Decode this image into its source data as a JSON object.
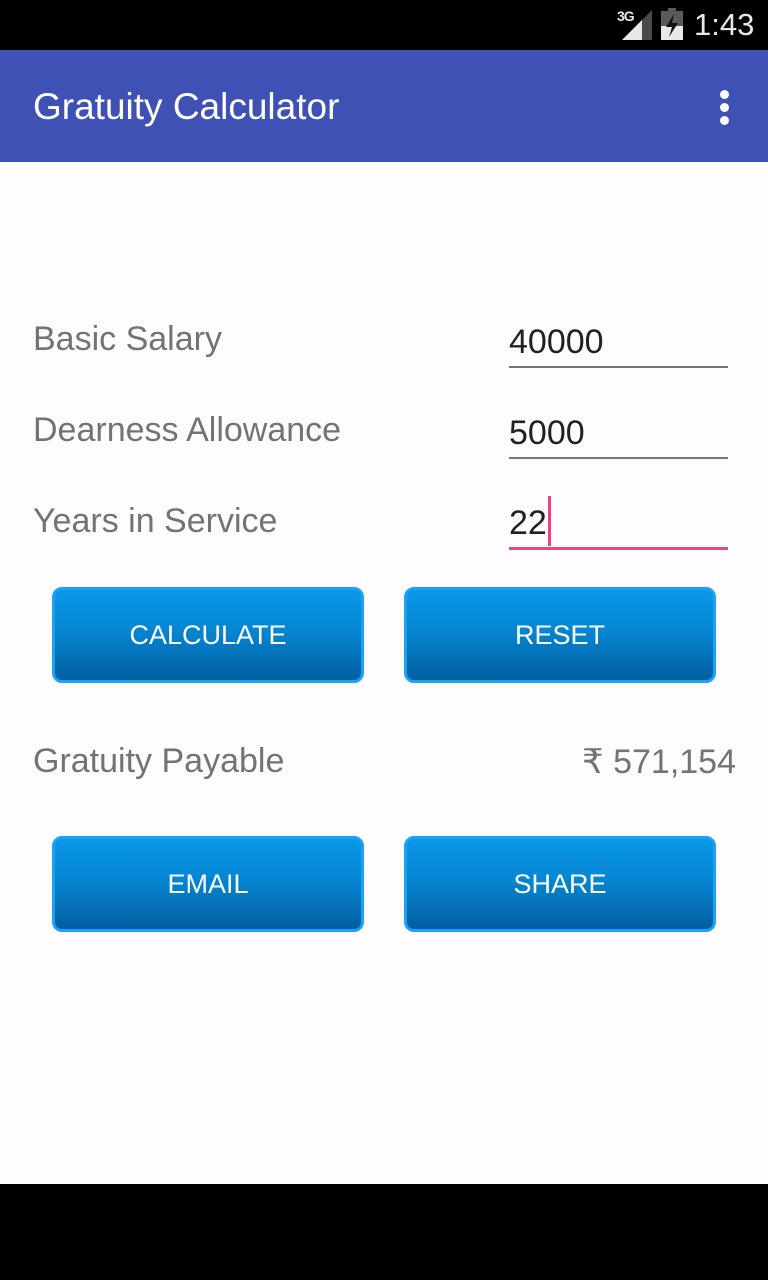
{
  "status_bar": {
    "network": "3G",
    "time": "1:43",
    "icons": [
      "signal-icon",
      "battery-charging-icon"
    ]
  },
  "app_bar": {
    "title": "Gratuity Calculator",
    "overflow_icon": "more-vert-icon"
  },
  "form": {
    "fields": [
      {
        "label": "Basic Salary",
        "value": "40000"
      },
      {
        "label": "Dearness Allowance",
        "value": "5000"
      },
      {
        "label": "Years in Service",
        "value": "22"
      }
    ],
    "accent_color": "#e8457f"
  },
  "buttons": {
    "calculate": "CALCULATE",
    "reset": "RESET",
    "email": "EMAIL",
    "share": "SHARE"
  },
  "result": {
    "label": "Gratuity Payable",
    "value": "₹ 571,154"
  },
  "colors": {
    "primary": "#3f51b5",
    "button": "#0586d2"
  }
}
